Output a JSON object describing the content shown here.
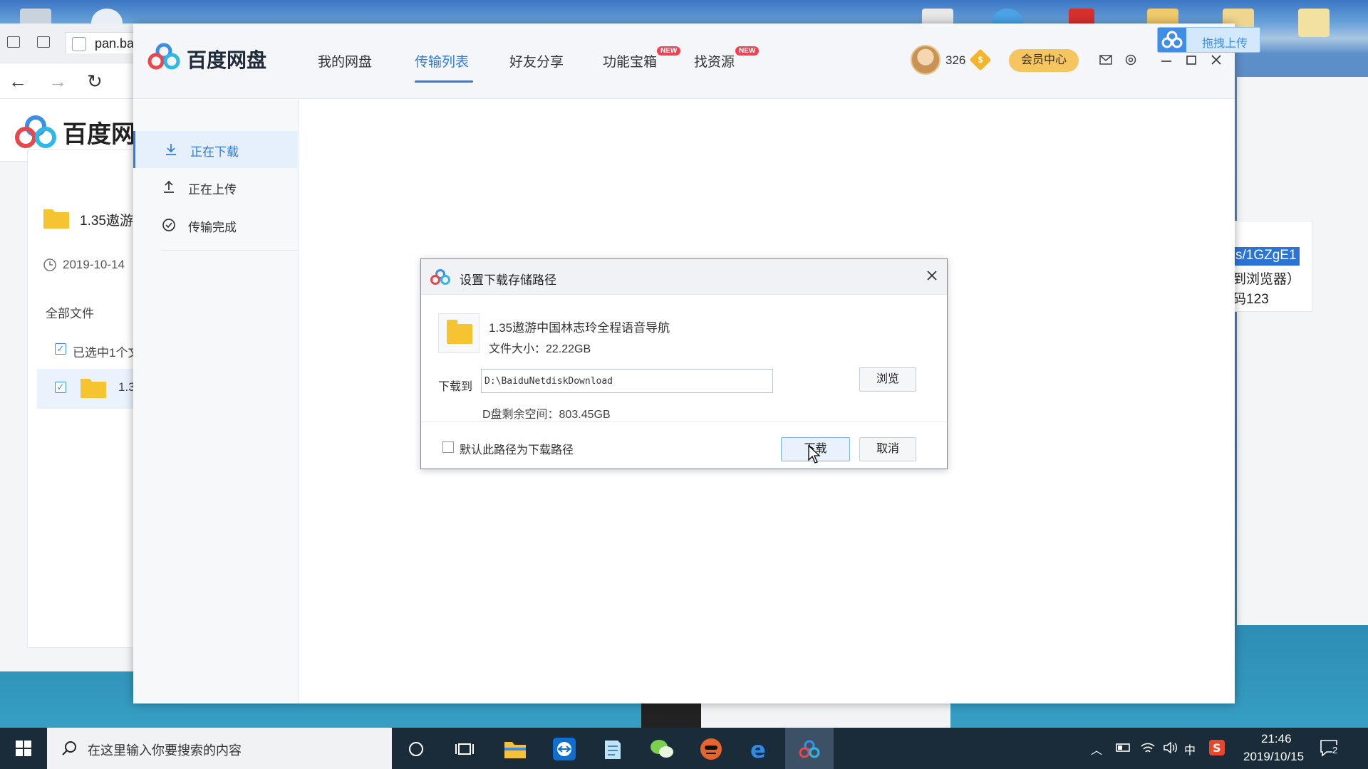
{
  "browser": {
    "tab_title": "pan.ba",
    "logo_text": "百度网",
    "folder_name": "1.35遨游",
    "date": "2019-10-14",
    "all_files": "全部文件",
    "selected_text": "已选中1个文",
    "row_text": "1.3",
    "link_text": "s/1GZgE1",
    "line2": "到浏览器）",
    "line3": "码123"
  },
  "app": {
    "logo_text": "百度网盘",
    "nav": [
      {
        "label": "我的网盘"
      },
      {
        "label": "传输列表"
      },
      {
        "label": "好友分享"
      },
      {
        "label": "功能宝箱",
        "badge": "NEW"
      },
      {
        "label": "找资源",
        "badge": "NEW"
      }
    ],
    "coins": "326",
    "coin_symbol": "$",
    "vip_label": "会员中心",
    "drag_upload": "拖拽上传",
    "sidebar": [
      {
        "label": "正在下载"
      },
      {
        "label": "正在上传"
      },
      {
        "label": "传输完成"
      }
    ]
  },
  "dialog": {
    "title": "设置下载存储路径",
    "file_name": "1.35遨游中国林志玲全程语音导航",
    "file_size": "文件大小：22.22GB",
    "save_to_label": "下载到",
    "path_value": "D:\\BaiduNetdiskDownload",
    "browse_label": "浏览",
    "free_space": "D盘剩余空间：803.45GB",
    "default_path_label": "默认此路径为下载路径",
    "default_checked": false,
    "download_label": "下载",
    "cancel_label": "取消"
  },
  "taskbar": {
    "search_placeholder": "在这里输入你要搜索的内容",
    "ime": "中",
    "time": "21:46",
    "date": "2019/10/15",
    "notification_count": "2"
  },
  "colors": {
    "accent": "#2d7be5",
    "vip": "#f5c55f",
    "badge": "#f2414f",
    "folder": "#f6c331"
  }
}
